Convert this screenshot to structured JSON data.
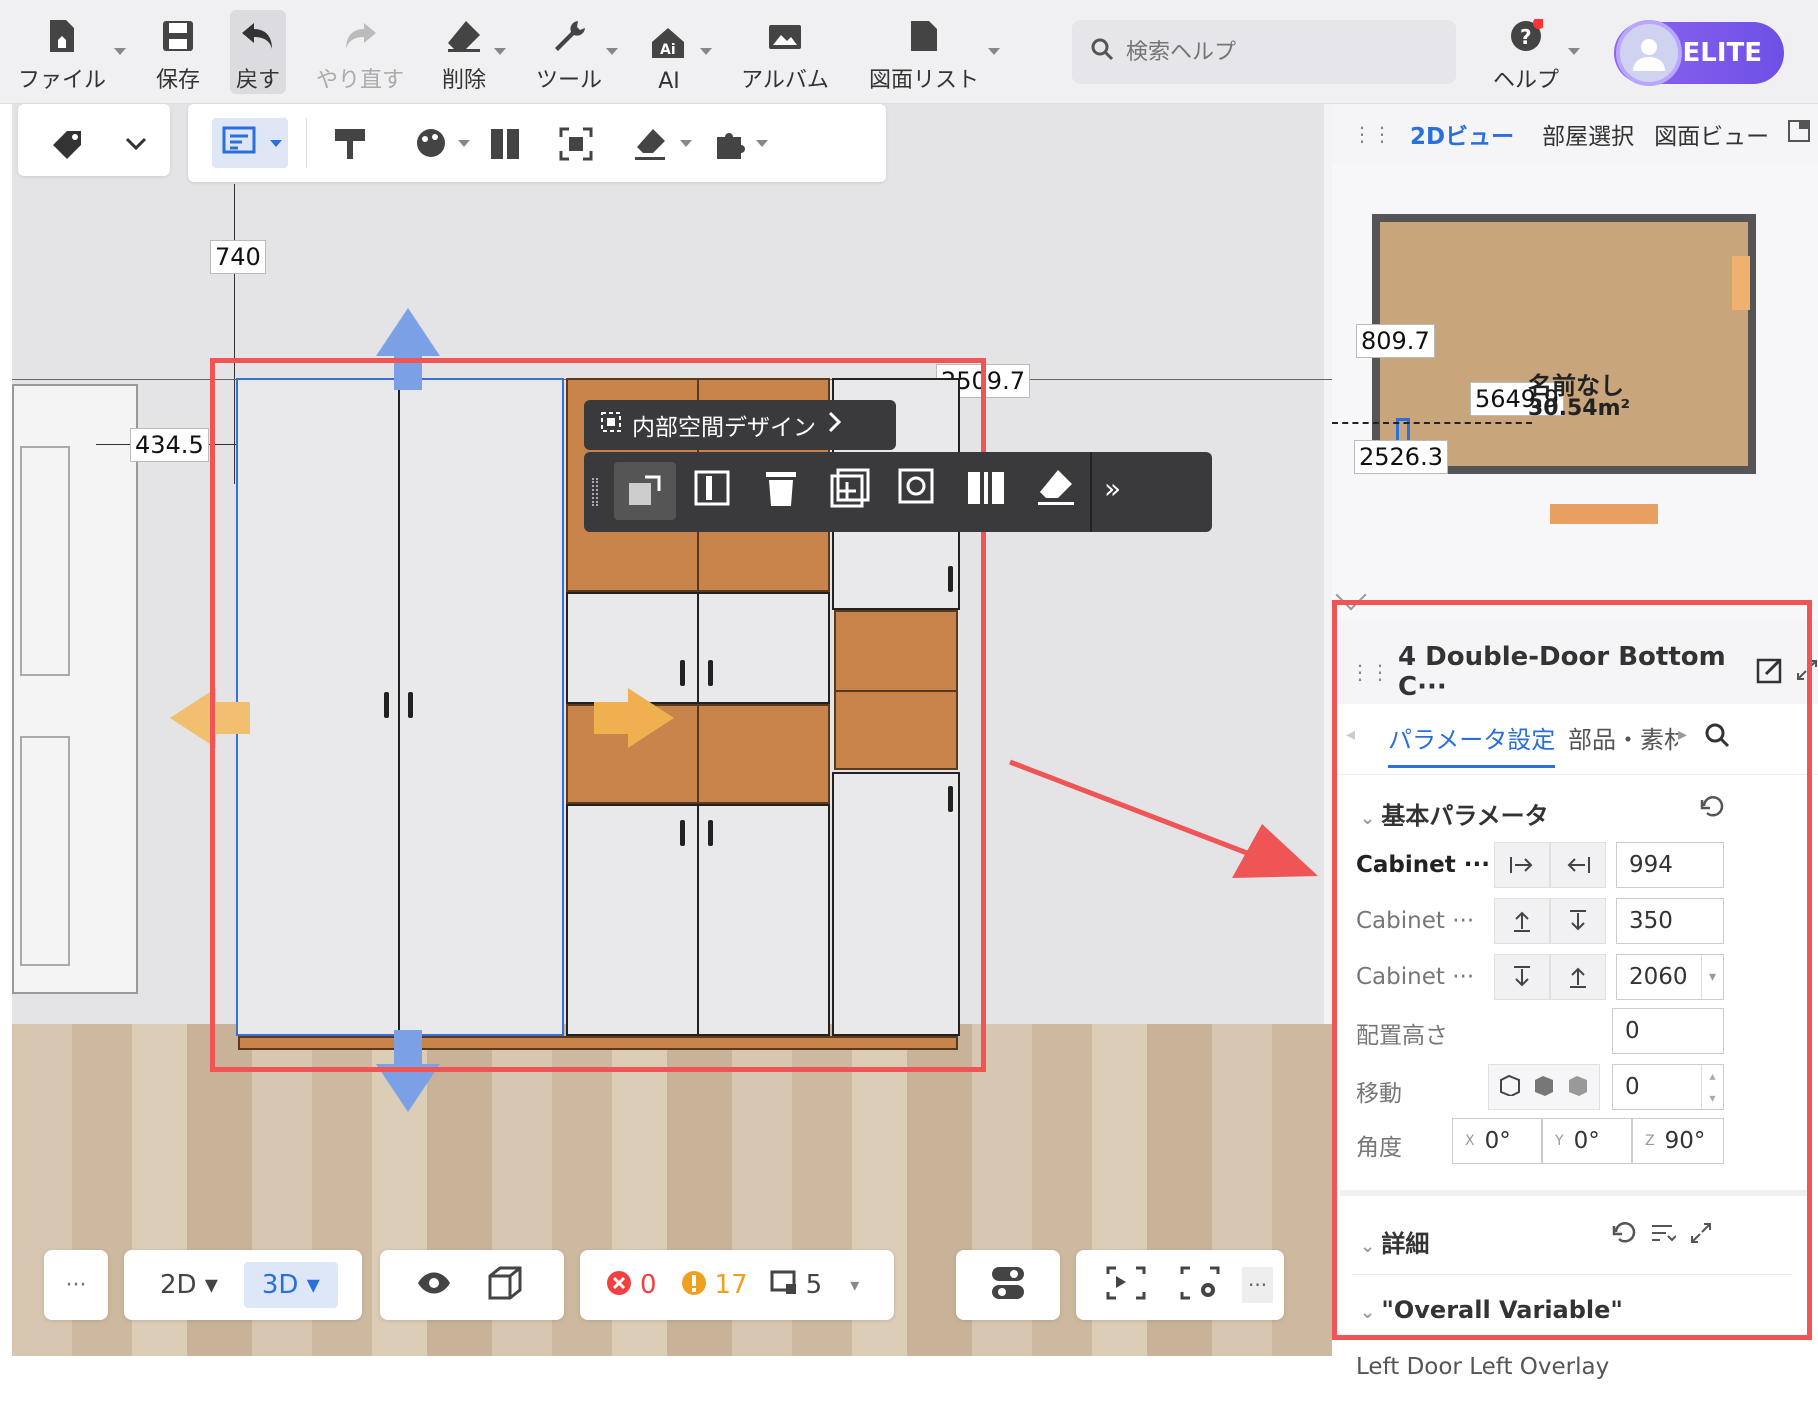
{
  "toolbar": {
    "file": "ファイル",
    "save": "保存",
    "undo": "戻す",
    "redo": "やり直す",
    "delete": "削除",
    "tools": "ツール",
    "ai": "AI",
    "album": "アルバム",
    "drawing_list": "図面リスト",
    "help": "ヘルプ",
    "search_placeholder": "検索ヘルプ",
    "plan_badge": "ELITE"
  },
  "dimensions": {
    "top": "740",
    "left": "434.5",
    "right": "2509.7"
  },
  "context": {
    "interior_design": "内部空間デザイン",
    "more": "»"
  },
  "view_tabs": {
    "tab_2d": "2Dビュー",
    "tab_room": "部屋選択",
    "tab_drawing": "図面ビュー"
  },
  "minimap": {
    "dim1": "809.7",
    "dim2": "5649.9",
    "dim3": "2526.3",
    "room_name": "名前なし",
    "area": "30.54m²"
  },
  "properties": {
    "title": "4 Double-Door Bottom C···",
    "tab_params": "パラメータ設定",
    "tab_parts": "部品・素材",
    "section_basic": "基本パラメータ",
    "width_label": "Cabinet ···",
    "width_value": "994",
    "depth_label": "Cabinet ···",
    "depth_value": "350",
    "height_label": "Cabinet ···",
    "height_value": "2060",
    "placement_label": "配置高さ",
    "placement_value": "0",
    "move_label": "移動",
    "move_value": "0",
    "angle_label": "角度",
    "angle_x_label": "X",
    "angle_x": "0°",
    "angle_y_label": "Y",
    "angle_y": "0°",
    "angle_z_label": "Z",
    "angle_z": "90°",
    "section_detail": "詳細",
    "section_overall": "\"Overall Variable\"",
    "left_door_overlay": "Left Door Left Overlay"
  },
  "bottombar": {
    "dots": "···",
    "mode_2d": "2D",
    "mode_3d": "3D",
    "errors": "0",
    "warnings": "17",
    "items": "5",
    "dots2": "···"
  },
  "colors": {
    "accent": "#2a6fdb",
    "highlight_red": "#f05555",
    "elite_purple": "#7b57ec",
    "wood": "#c8844a"
  }
}
